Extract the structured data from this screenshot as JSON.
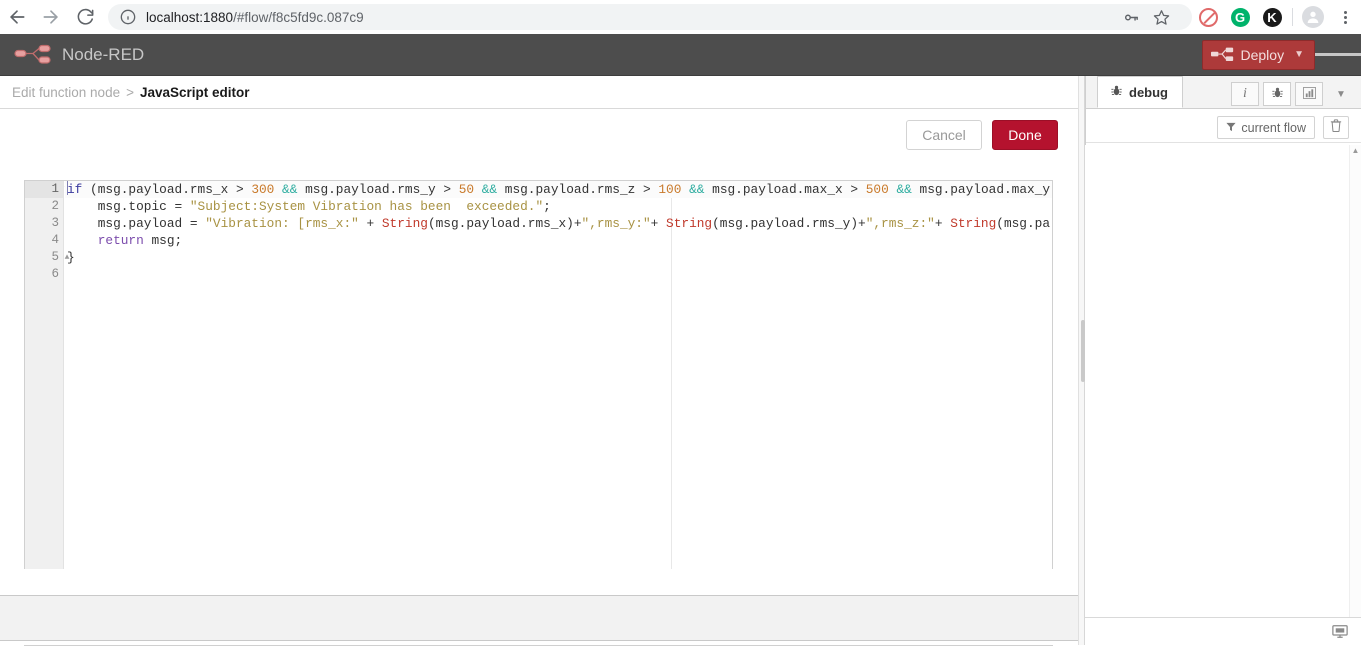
{
  "browser": {
    "back_label": "back-arrow",
    "forward_label": "forward-arrow",
    "reload_label": "reload",
    "url_host": "localhost:1880",
    "url_path": "/#flow/f8c5fd9c.087c9",
    "url_full": "localhost:1880/#flow/f8c5fd9c.087c9",
    "extensions": [
      {
        "name": "adblock-extension",
        "label": ""
      },
      {
        "name": "grammarly-extension",
        "label": "G"
      },
      {
        "name": "kaspersky-extension",
        "label": "K"
      }
    ]
  },
  "app": {
    "title": "Node-RED",
    "deploy_label": "Deploy"
  },
  "breadcrumb": {
    "previous": "Edit function node",
    "separator": ">",
    "current": "JavaScript editor"
  },
  "toolbar": {
    "cancel_label": "Cancel",
    "done_label": "Done"
  },
  "editor": {
    "line_numbers": [
      "1",
      "2",
      "3",
      "4",
      "5",
      "6"
    ],
    "active_line": 1,
    "fold_open_line": 1,
    "fold_close_line": 5,
    "lines": [
      {
        "number": "1",
        "tokens": [
          {
            "t": "if",
            "c": "k-kw"
          },
          {
            "t": " (msg.payload.rms_x > ",
            "c": "k-txt"
          },
          {
            "t": "300",
            "c": "k-num"
          },
          {
            "t": " ",
            "c": "k-txt"
          },
          {
            "t": "&&",
            "c": "k-op"
          },
          {
            "t": " msg.payload.rms_y > ",
            "c": "k-txt"
          },
          {
            "t": "50",
            "c": "k-num"
          },
          {
            "t": " ",
            "c": "k-txt"
          },
          {
            "t": "&&",
            "c": "k-op"
          },
          {
            "t": " msg.payload.rms_z > ",
            "c": "k-txt"
          },
          {
            "t": "100",
            "c": "k-num"
          },
          {
            "t": " ",
            "c": "k-txt"
          },
          {
            "t": "&&",
            "c": "k-op"
          },
          {
            "t": " msg.payload.max_x > ",
            "c": "k-txt"
          },
          {
            "t": "500",
            "c": "k-num"
          },
          {
            "t": " ",
            "c": "k-txt"
          },
          {
            "t": "&&",
            "c": "k-op"
          },
          {
            "t": " msg.payload.max_y",
            "c": "k-txt"
          }
        ]
      },
      {
        "number": "2",
        "tokens": [
          {
            "t": "    msg.topic = ",
            "c": "k-txt"
          },
          {
            "t": "\"Subject:System Vibration has been  exceeded.\"",
            "c": "k-str"
          },
          {
            "t": ";",
            "c": "k-txt"
          }
        ]
      },
      {
        "number": "3",
        "tokens": [
          {
            "t": "    msg.payload = ",
            "c": "k-txt"
          },
          {
            "t": "\"Vibration: [rms_x:\"",
            "c": "k-str"
          },
          {
            "t": " + ",
            "c": "k-txt"
          },
          {
            "t": "String",
            "c": "k-fn"
          },
          {
            "t": "(msg.payload.rms_x)+",
            "c": "k-txt"
          },
          {
            "t": "\",rms_y:\"",
            "c": "k-str"
          },
          {
            "t": "+ ",
            "c": "k-txt"
          },
          {
            "t": "String",
            "c": "k-fn"
          },
          {
            "t": "(msg.payload.rms_y)+",
            "c": "k-txt"
          },
          {
            "t": "\",rms_z:\"",
            "c": "k-str"
          },
          {
            "t": "+ ",
            "c": "k-txt"
          },
          {
            "t": "String",
            "c": "k-fn"
          },
          {
            "t": "(msg.pa",
            "c": "k-txt"
          }
        ]
      },
      {
        "number": "4",
        "tokens": [
          {
            "t": "    ",
            "c": "k-txt"
          },
          {
            "t": "return",
            "c": "k-ret"
          },
          {
            "t": " msg;",
            "c": "k-txt"
          }
        ]
      },
      {
        "number": "5",
        "tokens": [
          {
            "t": "}",
            "c": "k-txt"
          }
        ]
      },
      {
        "number": "6",
        "tokens": []
      }
    ]
  },
  "sidebar": {
    "tab_label": "debug",
    "tab_icon": "bug-icon",
    "action_buttons": [
      {
        "name": "info-tab-button",
        "glyph": "i"
      },
      {
        "name": "debug-tab-button",
        "glyph": "bug"
      },
      {
        "name": "dashboard-tab-button",
        "glyph": "chart"
      },
      {
        "name": "sidebar-menu-button",
        "glyph": "caret"
      }
    ],
    "filter_label": "current flow",
    "filter_icon": "funnel-icon",
    "clear_icon": "trash-icon",
    "footer_icon": "monitor-icon"
  },
  "colors": {
    "nr_header_bg": "#4d4d4d",
    "deploy_bg": "#ad3a3a",
    "done_bg": "#b5122e",
    "accent_red": "#b5122e"
  }
}
